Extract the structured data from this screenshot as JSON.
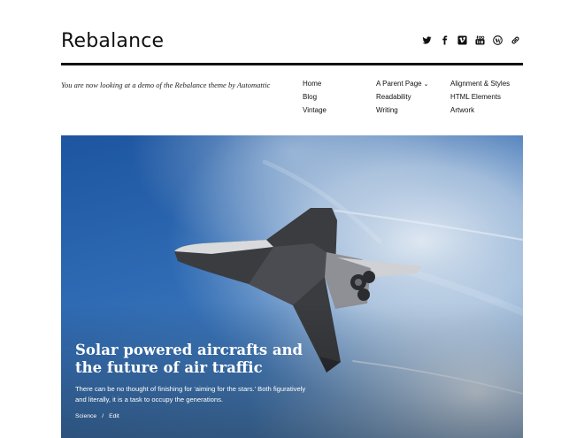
{
  "site": {
    "title": "Rebalance",
    "tagline": "You are now looking at a demo of the Rebalance theme by Automattic"
  },
  "social": [
    {
      "name": "twitter-icon"
    },
    {
      "name": "facebook-icon"
    },
    {
      "name": "vimeo-icon"
    },
    {
      "name": "youtube-icon"
    },
    {
      "name": "wordpress-icon"
    },
    {
      "name": "link-icon"
    }
  ],
  "menu": {
    "home": "Home",
    "parent": "A Parent Page",
    "alignment": "Alignment & Styles",
    "blog": "Blog",
    "readability": "Readability",
    "html": "HTML Elements",
    "vintage": "Vintage",
    "writing": "Writing",
    "artwork": "Artwork"
  },
  "featured": {
    "title": "Solar powered aircrafts and the future of air traffic",
    "excerpt": "There can be no thought of finishing for ‘aiming for the stars.’ Both figuratively and literally, it is a task to occupy the generations.",
    "category": "Science",
    "separator": "/",
    "edit": "Edit"
  },
  "colors": {
    "sky_top": "#1f5aa6",
    "sky_bottom": "#3d7bc2",
    "cloud": "#dde6ef",
    "shuttle": "#3a3c40",
    "text": "#111111"
  }
}
